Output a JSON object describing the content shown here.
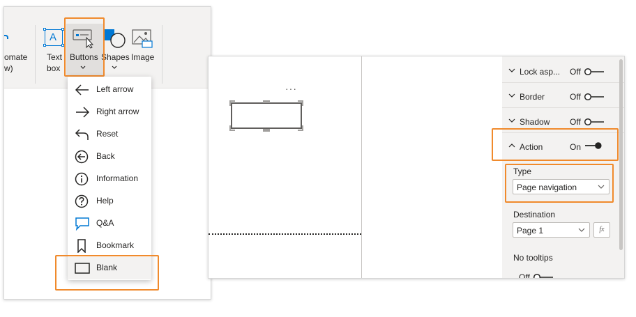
{
  "ribbon": {
    "automate_label_1": "omate",
    "automate_label_2": "w)",
    "textbox_label_1": "Text",
    "textbox_label_2": "box",
    "buttons_label": "Buttons",
    "shapes_label": "Shapes",
    "image_label": "Image",
    "textbox_glyph": "A"
  },
  "buttons_menu": {
    "items": [
      {
        "label": "Left arrow",
        "icon": "left-arrow-icon"
      },
      {
        "label": "Right arrow",
        "icon": "right-arrow-icon"
      },
      {
        "label": "Reset",
        "icon": "reset-icon"
      },
      {
        "label": "Back",
        "icon": "back-circle-icon"
      },
      {
        "label": "Information",
        "icon": "information-icon"
      },
      {
        "label": "Help",
        "icon": "help-icon"
      },
      {
        "label": "Q&A",
        "icon": "qna-icon"
      },
      {
        "label": "Bookmark",
        "icon": "bookmark-icon"
      },
      {
        "label": "Blank",
        "icon": "blank-rectangle-icon"
      }
    ],
    "selected": "Blank"
  },
  "canvas": {
    "more_options": "···"
  },
  "format_pane": {
    "sections": [
      {
        "label": "Lock asp...",
        "value": "Off",
        "on": false
      },
      {
        "label": "Border",
        "value": "Off",
        "on": false
      },
      {
        "label": "Shadow",
        "value": "Off",
        "on": false
      },
      {
        "label": "Action",
        "value": "On",
        "on": true
      }
    ],
    "type_label": "Type",
    "type_value": "Page navigation",
    "destination_label": "Destination",
    "destination_value": "Page 1",
    "fx_label": "fx",
    "tooltips_label": "No tooltips",
    "tooltips_value": "Off"
  },
  "colors": {
    "highlight": "#f08a2c",
    "accent_blue": "#0078d4",
    "toggle_dark": "#252423"
  }
}
